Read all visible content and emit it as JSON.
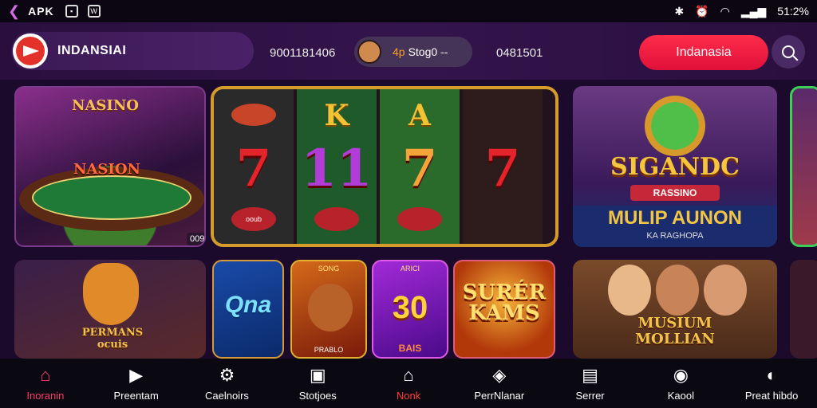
{
  "status_bar": {
    "app": "APK",
    "battery": "51:2%"
  },
  "header": {
    "brand": "INDANSIAI",
    "stat_left": "9001181406",
    "user": {
      "prefix": "4p",
      "name": "Stog0 --"
    },
    "stat_right": "0481501",
    "cta_label": "Indanasia"
  },
  "tiles": {
    "nasino": {
      "title": "NASINO",
      "sub": "NASION",
      "code": "009"
    },
    "slot": {
      "reels": [
        {
          "top": "",
          "mid": "7",
          "bot": "ooub"
        },
        {
          "top": "K",
          "mid": "11",
          "bot": ""
        },
        {
          "top": "A",
          "mid": "7",
          "bot": ""
        },
        {
          "top": "",
          "mid": "7",
          "bot": ""
        }
      ]
    },
    "sigano": {
      "title": "SIGANDC",
      "ribbon": "RASSINO",
      "sub": "MULIP AUNON",
      "small": "KA RAGHOPA"
    },
    "tiger": {
      "title": "PERMANS",
      "sub": "ocuis"
    },
    "qna": {
      "title": "Qna"
    },
    "king": {
      "top": "SONG",
      "bottom": "PRABLO"
    },
    "p30": {
      "top": "ARICI",
      "number": "30",
      "bottom": "BAIS"
    },
    "super": {
      "line1": "SURÉR",
      "line2": "KAMS"
    },
    "museum": {
      "line1": "MUSIUM",
      "line2": "MOLLIAN"
    }
  },
  "nav": [
    {
      "label": "Inoranin",
      "icon": "home-icon",
      "glyph": "⌂",
      "state": "active"
    },
    {
      "label": "Preentam",
      "icon": "play-icon",
      "glyph": "▶",
      "state": ""
    },
    {
      "label": "Caelnoirs",
      "icon": "gear-icon",
      "glyph": "⚙",
      "state": ""
    },
    {
      "label": "Stotjoes",
      "icon": "store-icon",
      "glyph": "▣",
      "state": ""
    },
    {
      "label": "Nonk",
      "icon": "house-outline-icon",
      "glyph": "⌂",
      "state": "alert"
    },
    {
      "label": "PerrNlanar",
      "icon": "badge-icon",
      "glyph": "◈",
      "state": ""
    },
    {
      "label": "Serrer",
      "icon": "server-icon",
      "glyph": "▤",
      "state": ""
    },
    {
      "label": "Kaool",
      "icon": "target-icon",
      "glyph": "◉",
      "state": ""
    },
    {
      "label": "Preat hibdo",
      "icon": "compass-icon",
      "glyph": "◐",
      "state": ""
    }
  ]
}
